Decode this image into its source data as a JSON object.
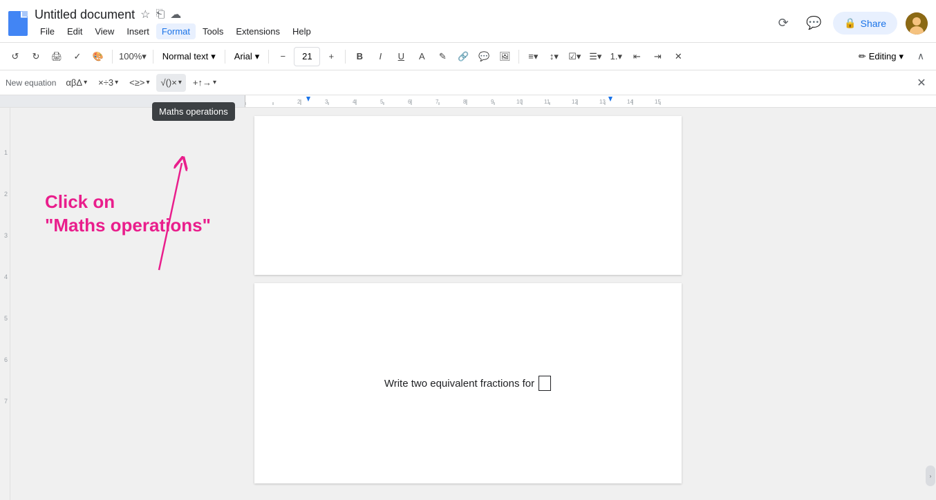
{
  "titlebar": {
    "doc_title": "Untitled document",
    "star_icon": "★",
    "folder_icon": "📁",
    "cloud_icon": "☁"
  },
  "menu": {
    "items": [
      "File",
      "Edit",
      "View",
      "Insert",
      "Format",
      "Tools",
      "Extensions",
      "Help"
    ]
  },
  "header_right": {
    "share_label": "Share"
  },
  "toolbar": {
    "undo": "↺",
    "redo": "↻",
    "print": "🖨",
    "paint_format": "🎨",
    "zoom": "100%",
    "style": "Normal text",
    "font": "Arial",
    "font_size": "21",
    "decrease_font": "−",
    "increase_font": "+",
    "editing": "Editing"
  },
  "eq_toolbar": {
    "new_eq": "New equation",
    "greek": "αβΔ ▾",
    "ops": "×÷3 ▾",
    "relations": "<≥> ▾",
    "radicals": "√()× ▾",
    "arrows": "+↑→ ▾"
  },
  "tooltip": {
    "text": "Maths operations"
  },
  "annotation": {
    "line1": "Click on",
    "line2": "\"Maths operations\""
  },
  "page2": {
    "text": "Write two equivalent fractions for"
  }
}
